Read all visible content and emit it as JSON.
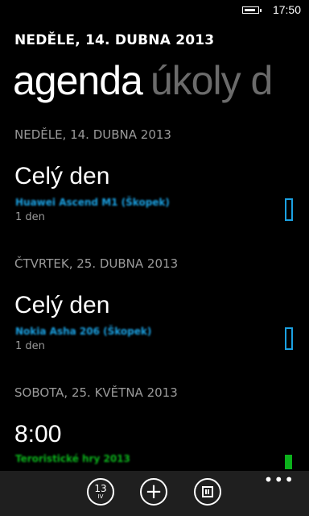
{
  "status_bar": {
    "time": "17:50",
    "battery_level": 0.75
  },
  "header": {
    "date": "NEDĚLE, 14. DUBNA 2013"
  },
  "pivot": {
    "active": "agenda",
    "next": "úkoly d"
  },
  "sections": [
    {
      "header": "NEDĚLE, 14. DUBNA 2013",
      "event": {
        "time": "Celý den",
        "title": "Huawei Ascend M1 (Škopek)",
        "duration": "1 den",
        "color": "#1ba1e2",
        "marker": "outline"
      }
    },
    {
      "header": "ČTVRTEK, 25. DUBNA 2013",
      "event": {
        "time": "Celý den",
        "title": "Nokia Asha 206 (Škopek)",
        "duration": "1 den",
        "color": "#1ba1e2",
        "marker": "outline"
      }
    },
    {
      "header": "SOBOTA, 25. KVĚTNA 2013",
      "event": {
        "time": "8:00",
        "title": "Teroristické hry 2013",
        "duration": "",
        "color": "#0bb11b",
        "marker": "solid"
      }
    }
  ],
  "app_bar": {
    "today_day": "13",
    "today_month": "IV",
    "add_label": "+",
    "more_label": "•••"
  },
  "icons": {
    "battery": "battery-icon",
    "today": "calendar-today-icon",
    "add": "plus-icon",
    "calendar": "calendar-grid-icon",
    "more": "ellipsis-icon"
  }
}
